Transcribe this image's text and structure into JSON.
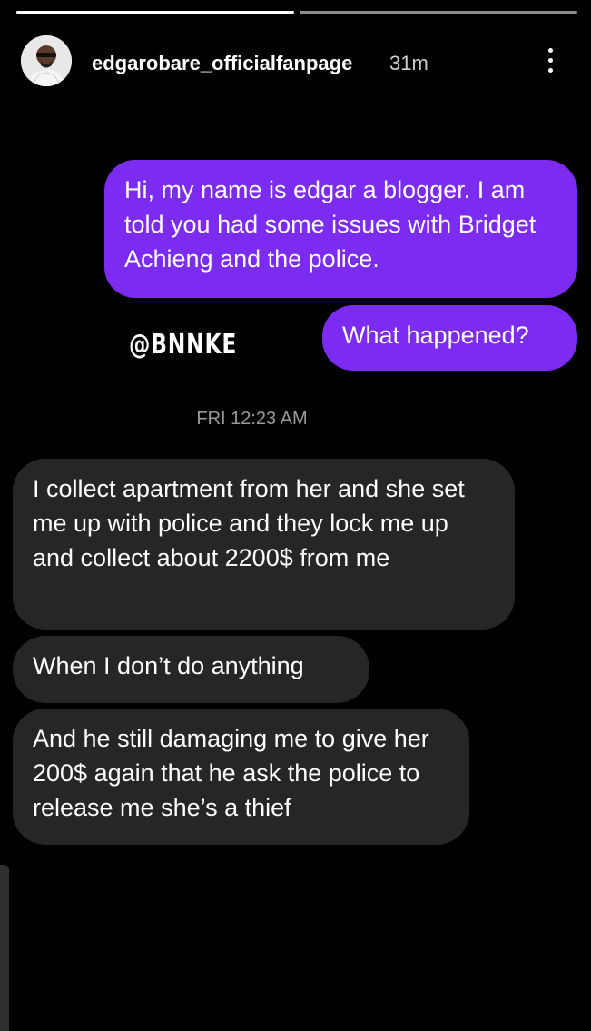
{
  "progress": {
    "segments": 2,
    "active_index": 0
  },
  "header": {
    "username": "edgarobare_officialfanpage",
    "time": "31m",
    "avatar_icon": "user-avatar-icon",
    "more_icon": "more-vertical-icon"
  },
  "messages": {
    "sent": [
      "Hi, my name is edgar a blogger. I am told you had some issues with Bridget Achieng and the police.",
      "What happened?"
    ],
    "timestamp": "FRI 12:23 AM",
    "received": [
      "I collect apartment from her and she set me up with police and they lock me up and collect about 2200$ from me",
      "When I don’t do anything",
      "And he still damaging me to give her  200$ again that he ask the police to release me she’s a thief"
    ]
  },
  "watermark": "@BNNKE",
  "colors": {
    "sent_bubble": "#7c2bf0",
    "received_bubble": "#262626",
    "background": "#000000"
  }
}
